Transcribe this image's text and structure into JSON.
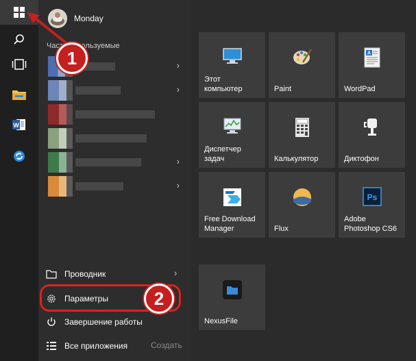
{
  "user": {
    "name": "Monday"
  },
  "most_used": {
    "label": "Часто используемые"
  },
  "apps": [
    {
      "thumb_color": "#4b6fb0",
      "has_arrow": true
    },
    {
      "thumb_color": "#6d86b8",
      "has_arrow": true
    },
    {
      "thumb_color": "#8f2a2a",
      "has_arrow": false
    },
    {
      "thumb_color": "#8aa07e",
      "has_arrow": false
    },
    {
      "thumb_color": "#3e7a4a",
      "has_arrow": true
    },
    {
      "thumb_color": "#d88a3a",
      "has_arrow": true
    }
  ],
  "menu": {
    "explorer": "Проводник",
    "settings": "Параметры",
    "shutdown": "Завершение работы",
    "all_apps": "Все приложения",
    "create": "Создать"
  },
  "tiles": [
    {
      "label": "Этот\nкомпьютер",
      "icon": "computer-icon"
    },
    {
      "label": "Paint",
      "icon": "paint-palette-icon"
    },
    {
      "label": "WordPad",
      "icon": "wordpad-icon"
    },
    {
      "label": "Диспетчер\nзадач",
      "icon": "task-manager-icon"
    },
    {
      "label": "Калькулятор",
      "icon": "calculator-icon"
    },
    {
      "label": "Диктофон",
      "icon": "microphone-icon"
    },
    {
      "label": "Free Download\nManager",
      "icon": "fdm-icon"
    },
    {
      "label": "Flux",
      "icon": "flux-icon"
    },
    {
      "label": "Adobe\nPhotoshop CS6",
      "icon": "photoshop-icon"
    },
    {
      "label": "NexusFile",
      "icon": "nexusfile-icon"
    }
  ],
  "annotations": {
    "step1": "1",
    "step2": "2"
  },
  "colors": {
    "annotation_red": "#c51f1f",
    "tile_bg": "#3c3c3c",
    "taskbar_bg": "#1f1f1f"
  }
}
